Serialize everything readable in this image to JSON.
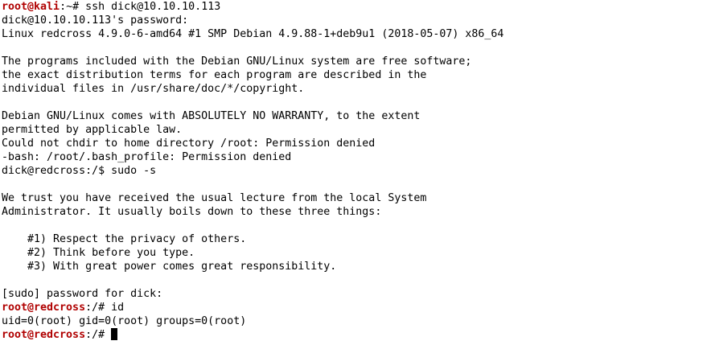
{
  "colors": {
    "background": "#ffffff",
    "text": "#000000",
    "prompt_user": "#b00000",
    "cursor": "#000000"
  },
  "terminal": {
    "lines": {
      "l1": {
        "user": "root@kali",
        "sep": ":~# ",
        "cmd": "ssh dick@10.10.10.113"
      },
      "l2": "dick@10.10.10.113's password:",
      "l3": "Linux redcross 4.9.0-6-amd64 #1 SMP Debian 4.9.88-1+deb9u1 (2018-05-07) x86_64",
      "l4": "",
      "l5": "The programs included with the Debian GNU/Linux system are free software;",
      "l6": "the exact distribution terms for each program are described in the",
      "l7": "individual files in /usr/share/doc/*/copyright.",
      "l8": "",
      "l9": "Debian GNU/Linux comes with ABSOLUTELY NO WARRANTY, to the extent",
      "l10": "permitted by applicable law.",
      "l11": "Could not chdir to home directory /root: Permission denied",
      "l12": "-bash: /root/.bash_profile: Permission denied",
      "l13": "dick@redcross:/$ sudo -s",
      "l14": "",
      "l15": "We trust you have received the usual lecture from the local System",
      "l16": "Administrator. It usually boils down to these three things:",
      "l17": "",
      "l18": "    #1) Respect the privacy of others.",
      "l19": "    #2) Think before you type.",
      "l20": "    #3) With great power comes great responsibility.",
      "l21": "",
      "l22": "[sudo] password for dick:",
      "l23": {
        "user": "root@redcross",
        "sep": ":/# ",
        "cmd": "id"
      },
      "l24": "uid=0(root) gid=0(root) groups=0(root)",
      "l25": {
        "user": "root@redcross",
        "sep": ":/# ",
        "cmd": ""
      }
    }
  }
}
